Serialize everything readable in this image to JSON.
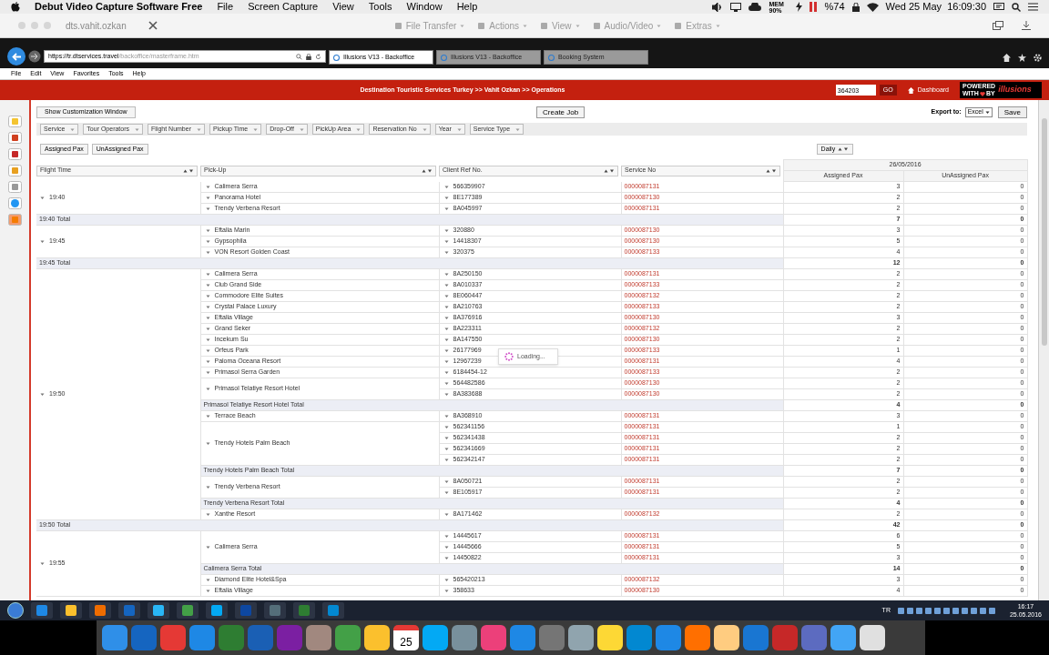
{
  "mac_menu": {
    "app": "Debut Video Capture Software Free",
    "items": [
      "File",
      "Screen Capture",
      "View",
      "Tools",
      "Window",
      "Help"
    ],
    "mem": "MEM 90%",
    "battery": "%74",
    "clock": "Wed 25 May  16:09:30"
  },
  "remote_toolbar": {
    "title": "dts.vahit.ozkan",
    "buttons": [
      "File Transfer",
      "Actions",
      "View",
      "Audio/Video",
      "Extras"
    ]
  },
  "browser": {
    "url_host": "https://tr.dtservices.travel",
    "url_path": "/backoffice/masterframe.htm",
    "tabs": [
      {
        "label": "Illusions V13 - Backoffice",
        "selected": true
      },
      {
        "label": "Illusions V13 - Backoffice",
        "selected": false
      },
      {
        "label": "Booking System",
        "selected": false
      }
    ],
    "menu": [
      "File",
      "Edit",
      "View",
      "Favorites",
      "Tools",
      "Help"
    ]
  },
  "header": {
    "breadcrumb": "Destination Touristic Services Turkey >> Vahit Ozkan >> Operations",
    "search_value": "364203",
    "go": "GO",
    "dashboard": "Dashboard",
    "logo_top": "POWERED",
    "logo_mid": "WITH",
    "logo_by": "BY",
    "logo_name": "illusions"
  },
  "toolbar": {
    "customize": "Show Customization Window",
    "create": "Create Job",
    "export_label": "Export to:",
    "export_value": "Excel",
    "save": "Save"
  },
  "filters": [
    "Service",
    "Tour Operators",
    "Flight Number",
    "Pickup Time",
    "Drop-Off",
    "PickUp Area",
    "Reservation No",
    "Year",
    "Service Type"
  ],
  "pax_buttons": [
    "Assigned Pax",
    "UnAssigned Pax"
  ],
  "period": "Daily",
  "columns": [
    "Flight Time",
    "Pick-Up",
    "Client Ref No.",
    "Service No"
  ],
  "date": "26/05/2016",
  "value_columns": [
    "Assigned Pax",
    "UnAssigned Pax"
  ],
  "groups": [
    {
      "flight": "19:40",
      "items": [
        {
          "hotel": "Calimera Serra",
          "refs": [
            {
              "ref": "566359907",
              "service": "0000087131",
              "assigned": "3",
              "unassigned": "0"
            }
          ]
        },
        {
          "hotel": "Panorama Hotel",
          "refs": [
            {
              "ref": "8E177389",
              "service": "0000087130",
              "assigned": "2",
              "unassigned": "0"
            }
          ]
        },
        {
          "hotel": "Trendy Verbena Resort",
          "refs": [
            {
              "ref": "8A045997",
              "service": "0000087131",
              "assigned": "2",
              "unassigned": "0"
            }
          ]
        }
      ],
      "total": {
        "label": "19:40 Total",
        "assigned": "7",
        "unassigned": "0"
      }
    },
    {
      "flight": "19:45",
      "items": [
        {
          "hotel": "Eftalia Marin",
          "refs": [
            {
              "ref": "320880",
              "service": "0000087130",
              "assigned": "3",
              "unassigned": "0"
            }
          ]
        },
        {
          "hotel": "Gypsophila",
          "refs": [
            {
              "ref": "14418307",
              "service": "0000087130",
              "assigned": "5",
              "unassigned": "0"
            }
          ]
        },
        {
          "hotel": "VON Resort Golden Coast",
          "refs": [
            {
              "ref": "320375",
              "service": "0000087133",
              "assigned": "4",
              "unassigned": "0"
            }
          ]
        }
      ],
      "total": {
        "label": "19:45 Total",
        "assigned": "12",
        "unassigned": "0"
      }
    },
    {
      "flight": "19:50",
      "items": [
        {
          "hotel": "Calimera Serra",
          "refs": [
            {
              "ref": "8A250150",
              "service": "0000087131",
              "assigned": "2",
              "unassigned": "0"
            }
          ]
        },
        {
          "hotel": "Club Grand Side",
          "refs": [
            {
              "ref": "8A010337",
              "service": "0000087133",
              "assigned": "2",
              "unassigned": "0"
            }
          ]
        },
        {
          "hotel": "Commodore Elite Suites",
          "refs": [
            {
              "ref": "8E060447",
              "service": "0000087132",
              "assigned": "2",
              "unassigned": "0"
            }
          ]
        },
        {
          "hotel": "Crystal Palace Luxury",
          "refs": [
            {
              "ref": "8A210763",
              "service": "0000087133",
              "assigned": "2",
              "unassigned": "0"
            }
          ]
        },
        {
          "hotel": "Eftalia Village",
          "refs": [
            {
              "ref": "8A376916",
              "service": "0000087130",
              "assigned": "3",
              "unassigned": "0"
            }
          ]
        },
        {
          "hotel": "Grand Seker",
          "refs": [
            {
              "ref": "8A223311",
              "service": "0000087132",
              "assigned": "2",
              "unassigned": "0"
            }
          ]
        },
        {
          "hotel": "Incekum Su",
          "refs": [
            {
              "ref": "8A147550",
              "service": "0000087130",
              "assigned": "2",
              "unassigned": "0"
            }
          ]
        },
        {
          "hotel": "Orfeus Park",
          "refs": [
            {
              "ref": "26177969",
              "service": "0000087133",
              "assigned": "1",
              "unassigned": "0"
            }
          ]
        },
        {
          "hotel": "Paloma Oceana Resort",
          "refs": [
            {
              "ref": "12967239",
              "service": "0000087131",
              "assigned": "4",
              "unassigned": "0"
            }
          ]
        },
        {
          "hotel": "Primasol Serra Garden",
          "refs": [
            {
              "ref": "6184454-12",
              "service": "0000087133",
              "assigned": "2",
              "unassigned": "0"
            }
          ]
        },
        {
          "hotel": "Primasol Telatiye Resort Hotel",
          "refs": [
            {
              "ref": "564482586",
              "service": "0000087130",
              "assigned": "2",
              "unassigned": "0"
            },
            {
              "ref": "8A383688",
              "service": "0000087130",
              "assigned": "2",
              "unassigned": "0"
            }
          ],
          "subtotal": {
            "label": "Primasol Telatiye Resort Hotel Total",
            "assigned": "4",
            "unassigned": "0"
          }
        },
        {
          "hotel": "Terrace Beach",
          "refs": [
            {
              "ref": "8A368910",
              "service": "0000087131",
              "assigned": "3",
              "unassigned": "0"
            }
          ]
        },
        {
          "hotel": "Trendy Hotels Palm Beach",
          "refs": [
            {
              "ref": "562341156",
              "service": "0000087131",
              "assigned": "1",
              "unassigned": "0"
            },
            {
              "ref": "562341438",
              "service": "0000087131",
              "assigned": "2",
              "unassigned": "0"
            },
            {
              "ref": "562341669",
              "service": "0000087131",
              "assigned": "2",
              "unassigned": "0"
            },
            {
              "ref": "562342147",
              "service": "0000087131",
              "assigned": "2",
              "unassigned": "0"
            }
          ],
          "subtotal": {
            "label": "Trendy Hotels Palm Beach Total",
            "assigned": "7",
            "unassigned": "0"
          }
        },
        {
          "hotel": "Trendy Verbena Resort",
          "refs": [
            {
              "ref": "8A050721",
              "service": "0000087131",
              "assigned": "2",
              "unassigned": "0"
            },
            {
              "ref": "8E105917",
              "service": "0000087131",
              "assigned": "2",
              "unassigned": "0"
            }
          ],
          "subtotal": {
            "label": "Trendy Verbena Resort Total",
            "assigned": "4",
            "unassigned": "0"
          }
        },
        {
          "hotel": "Xanthe Resort",
          "refs": [
            {
              "ref": "8A171462",
              "service": "0000087132",
              "assigned": "2",
              "unassigned": "0"
            }
          ]
        }
      ],
      "total": {
        "label": "19:50 Total",
        "assigned": "42",
        "unassigned": "0"
      }
    },
    {
      "flight": "19:55",
      "items": [
        {
          "hotel": "Calimera Serra",
          "refs": [
            {
              "ref": "14445617",
              "service": "0000087131",
              "assigned": "6",
              "unassigned": "0"
            },
            {
              "ref": "14445666",
              "service": "0000087131",
              "assigned": "5",
              "unassigned": "0"
            },
            {
              "ref": "14450822",
              "service": "0000087131",
              "assigned": "3",
              "unassigned": "0"
            }
          ],
          "subtotal": {
            "label": "Calimera Serra Total",
            "assigned": "14",
            "unassigned": "0"
          }
        },
        {
          "hotel": "Diamond Elite Hotel&Spa",
          "refs": [
            {
              "ref": "565420213",
              "service": "0000087132",
              "assigned": "3",
              "unassigned": "0"
            }
          ]
        },
        {
          "hotel": "Eftalia Village",
          "refs": [
            {
              "ref": "358633",
              "service": "0000087130",
              "assigned": "4",
              "unassigned": "0"
            }
          ]
        }
      ]
    }
  ],
  "loading": "Loading...",
  "taskbar": {
    "lang": "TR",
    "time": "16:17",
    "date": "25.05.2016",
    "apps": [
      {
        "color": "#1e88e5"
      },
      {
        "color": "#fbc02d"
      },
      {
        "color": "#ef6c00"
      },
      {
        "color": "#1565c0"
      },
      {
        "color": "#29b6f6"
      },
      {
        "color": "#43a047"
      },
      {
        "color": "#03a9f4"
      },
      {
        "color": "#0d47a1"
      },
      {
        "color": "#546e7a"
      },
      {
        "color": "#2e7d32"
      },
      {
        "color": "#0288d1"
      }
    ]
  },
  "dock": {
    "calendar_day": "25",
    "apps": [
      {
        "color": "#2f8fe8"
      },
      {
        "color": "#1565c0"
      },
      {
        "color": "#e53935"
      },
      {
        "color": "#1e88e5"
      },
      {
        "color": "#2e7d32"
      },
      {
        "color": "#1a5fb4"
      },
      {
        "color": "#7b1fa2"
      },
      {
        "color": "#a1887f"
      },
      {
        "color": "#43a047"
      },
      {
        "color": "#fbc02d"
      },
      {
        "color": "#e53935"
      },
      {
        "color": "#03a9f4"
      },
      {
        "color": "#78909c"
      },
      {
        "color": "#ec407a"
      },
      {
        "color": "#1e88e5"
      },
      {
        "color": "#757575"
      },
      {
        "color": "#90a4ae"
      },
      {
        "color": "#fdd835"
      },
      {
        "color": "#0288d1"
      },
      {
        "color": "#1e88e5"
      },
      {
        "color": "#ff6f00"
      },
      {
        "color": "#ffcc80"
      },
      {
        "color": "#1976d2"
      },
      {
        "color": "#c62828"
      },
      {
        "color": "#5c6bc0"
      },
      {
        "color": "#42a5f5"
      },
      {
        "color": "#e0e0e0"
      }
    ]
  }
}
